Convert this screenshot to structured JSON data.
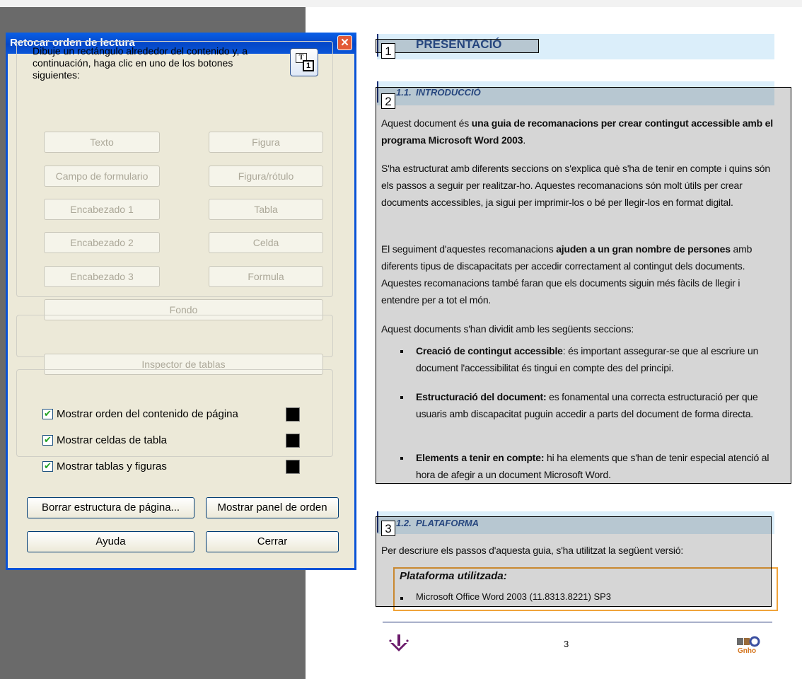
{
  "dialog": {
    "title": "Retocar orden de lectura",
    "close_glyph": "✕",
    "instructions": "Dibuje un rectángulo alrededor del contenido y, a continuación, haga clic en uno de los botones siguientes:",
    "reading_order_icon_letter": "T",
    "reading_order_icon_number": "1",
    "tag_buttons": {
      "texto": "Texto",
      "figura": "Figura",
      "campo_formulario": "Campo de formulario",
      "figura_rotulo": "Figura/rótulo",
      "encabezado1": "Encabezado 1",
      "tabla": "Tabla",
      "encabezado2": "Encabezado 2",
      "celda": "Celda",
      "encabezado3": "Encabezado 3",
      "formula": "Formula",
      "fondo": "Fondo"
    },
    "table_inspector": "Inspector de tablas",
    "checkboxes": [
      {
        "label": "Mostrar orden del contenido de página",
        "checked": true,
        "color": "#000000"
      },
      {
        "label": "Mostrar celdas de tabla",
        "checked": true,
        "color": "#000000"
      },
      {
        "label": "Mostrar tablas y figuras",
        "checked": true,
        "color": "#000000"
      }
    ],
    "checkmark": "✔",
    "buttons": {
      "clear_structure": "Borrar estructura de página...",
      "show_order_panel": "Mostrar panel de orden",
      "help": "Ayuda",
      "close": "Cerrar"
    }
  },
  "document": {
    "h1_number": "1",
    "h1_title": "PRESENTACIÓ",
    "h11_number": "1.1.",
    "h11_title": "INTRODUCCIÓ",
    "h12_number": "1.2.",
    "h12_title": "PLATAFORMA",
    "region_numbers": [
      "1",
      "2",
      "3"
    ],
    "p1_a": "Aquest document és ",
    "p1_b": "una guia de recomanacions per crear contingut accessible amb el programa Microsoft Word 2003",
    "p1_c": ".",
    "p2": "S'ha estructurat amb diferents seccions on s'explica què s'ha de tenir en compte i quins són els passos a seguir per realitzar-ho. Aquestes recomanacions són molt útils per crear documents accessibles, ja sigui per imprimir-los o bé per llegir-los en format digital.",
    "p3_a": "El seguiment d'aquestes recomanacions ",
    "p3_b": "ajuden a un gran nombre de persones",
    "p3_c": " amb diferents tipus de discapacitats per accedir correctament al contingut dels documents. Aquestes recomanacions també faran que els documents siguin més fàcils de llegir i entendre per a tot el món.",
    "p4": "Aquest documents s'han dividit amb les següents seccions:",
    "bullets": [
      {
        "bold": "Creació de contingut accessible",
        "rest": ": és important assegurar-se que al escriure un document l'accessibilitat és tingui en compte des del principi."
      },
      {
        "bold": "Estructuració del document:",
        "rest": " es fonamental una correcta estructuració per que usuaris amb discapacitat puguin accedir a parts del document de forma directa."
      },
      {
        "bold": "Elements a tenir en compte:",
        "rest": " hi ha elements que s'han de tenir especial atenció al hora de afegir a un document Microsoft Word."
      }
    ],
    "p5": "Per descriure els passos d'aquesta guia, s'ha utilitzat la següent versió:",
    "platform_label": "Plataforma utilitzada:",
    "platform_item": "Microsoft Office Word 2003 (11.8313.8221) SP3",
    "page_number": "3",
    "footer_logo_text": "Gnho"
  }
}
